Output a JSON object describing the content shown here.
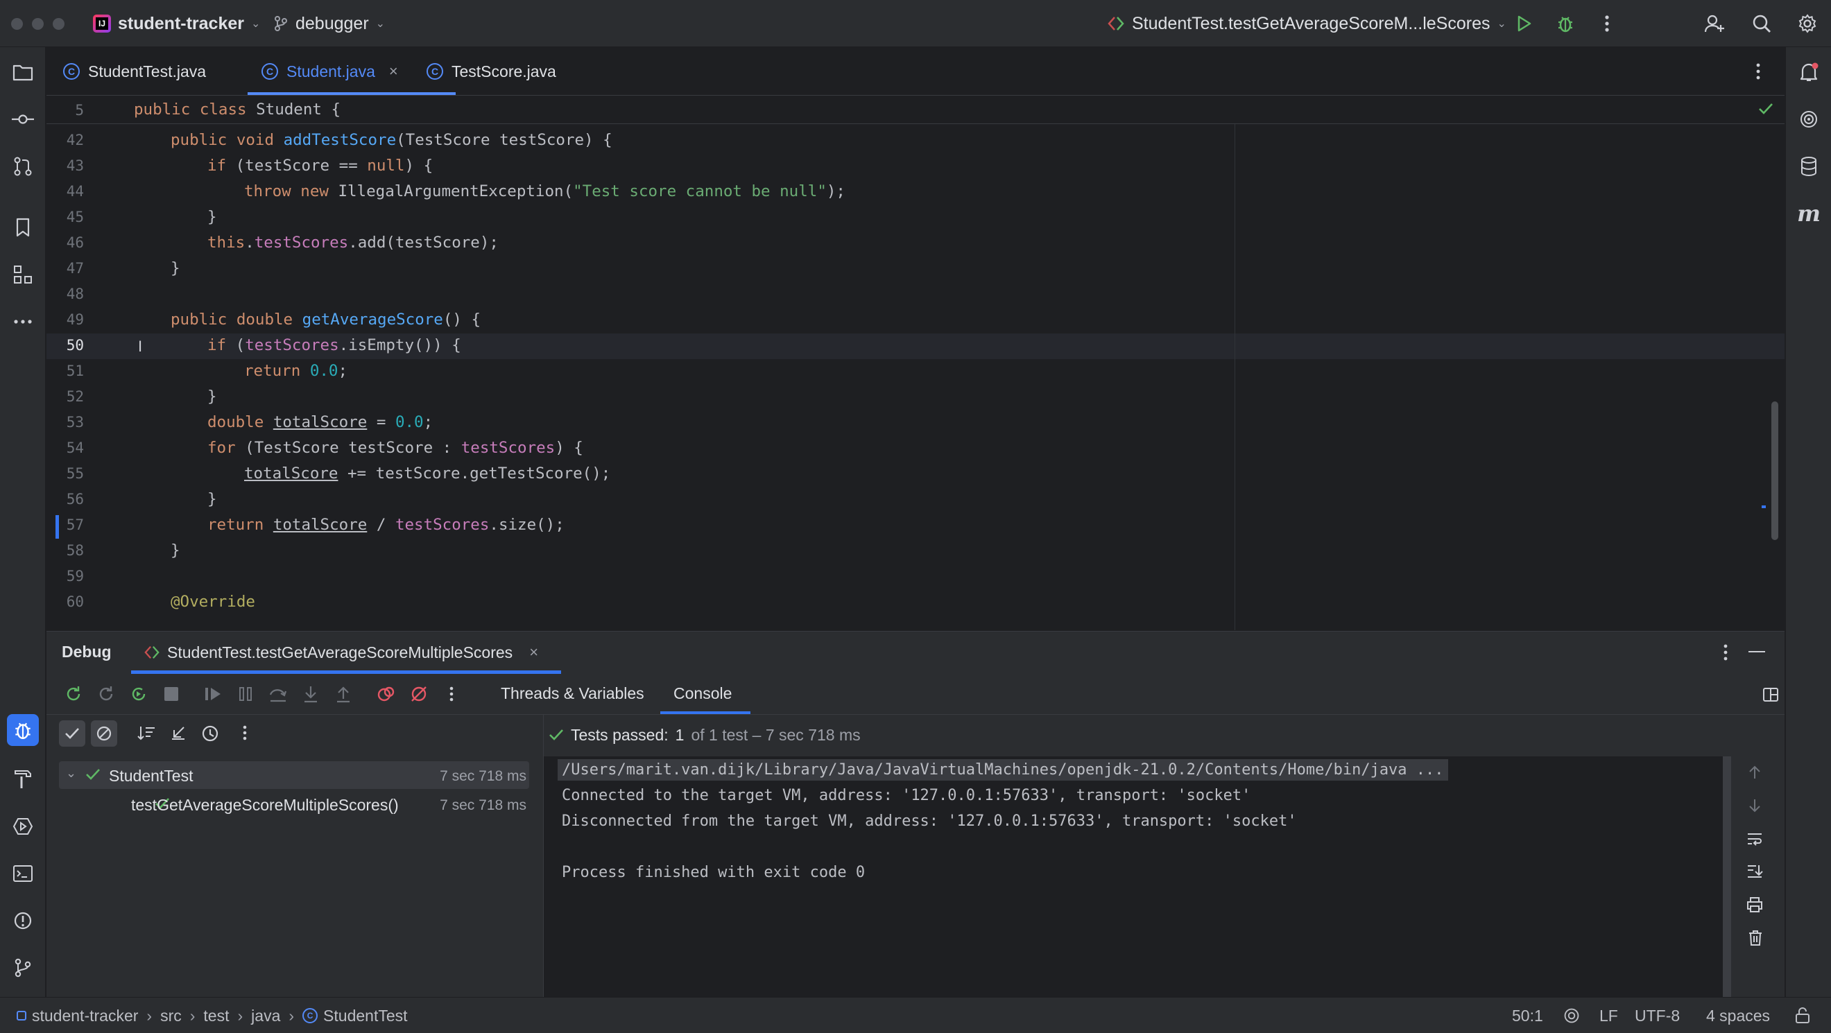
{
  "titlebar": {
    "project": "student-tracker",
    "project_badge": "IJ",
    "branch": "debugger",
    "run_config": "StudentTest.testGetAverageScoreM...leScores"
  },
  "tabs": [
    {
      "label": "StudentTest.java",
      "active": false
    },
    {
      "label": "Student.java",
      "active": true
    },
    {
      "label": "TestScore.java",
      "active": false
    }
  ],
  "editor": {
    "sticky_line_num": "5",
    "sticky_code": "public class Student {",
    "line_numbers": [
      "42",
      "43",
      "44",
      "45",
      "46",
      "47",
      "48",
      "49",
      "50",
      "51",
      "52",
      "53",
      "54",
      "55",
      "56",
      "57",
      "58",
      "59",
      "60"
    ],
    "current_line": "50"
  },
  "debug": {
    "title": "Debug",
    "session_tab": "StudentTest.testGetAverageScoreMultipleScores",
    "tab_threads": "Threads & Variables",
    "tab_console": "Console",
    "tests_passed_label": "Tests passed:",
    "tests_passed_count": "1",
    "tests_passed_rest": "of 1 test – 7 sec 718 ms",
    "tree": [
      {
        "label": "StudentTest",
        "time": "7 sec 718 ms"
      },
      {
        "label": "testGetAverageScoreMultipleScores()",
        "time": "7 sec 718 ms"
      }
    ],
    "console_lines": [
      "/Users/marit.van.dijk/Library/Java/JavaVirtualMachines/openjdk-21.0.2/Contents/Home/bin/java ...",
      "Connected to the target VM, address: '127.0.0.1:57633', transport: 'socket'",
      "Disconnected from the target VM, address: '127.0.0.1:57633', transport: 'socket'",
      "",
      "Process finished with exit code 0"
    ]
  },
  "statusbar": {
    "breadcrumbs": [
      "student-tracker",
      "src",
      "test",
      "java",
      "StudentTest"
    ],
    "position": "50:1",
    "line_ending": "LF",
    "encoding": "UTF-8",
    "indent": "4 spaces"
  },
  "colors": {
    "accent": "#548af7",
    "success": "#5fb865",
    "background": "#1e1f22",
    "panel": "#2b2d30"
  }
}
